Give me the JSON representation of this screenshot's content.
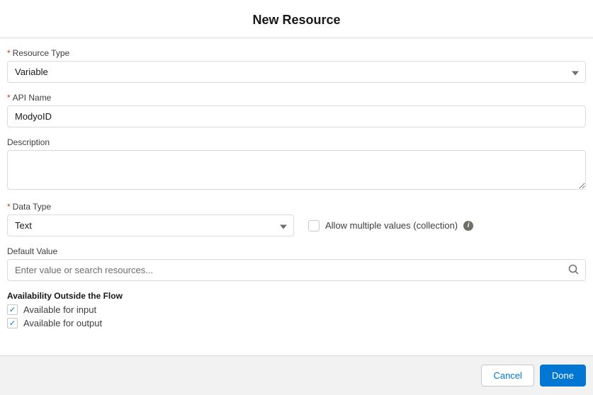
{
  "header": {
    "title": "New Resource"
  },
  "fields": {
    "resource_type": {
      "label": "Resource Type",
      "value": "Variable"
    },
    "api_name": {
      "label": "API Name",
      "value": "ModyoID"
    },
    "description": {
      "label": "Description",
      "value": ""
    },
    "data_type": {
      "label": "Data Type",
      "value": "Text"
    },
    "allow_multiple": {
      "label": "Allow multiple values (collection)",
      "checked": false
    },
    "default_value": {
      "label": "Default Value",
      "placeholder": "Enter value or search resources..."
    }
  },
  "availability": {
    "title": "Availability Outside the Flow",
    "input": {
      "label": "Available for input",
      "checked": true
    },
    "output": {
      "label": "Available for output",
      "checked": true
    }
  },
  "footer": {
    "cancel": "Cancel",
    "done": "Done"
  }
}
